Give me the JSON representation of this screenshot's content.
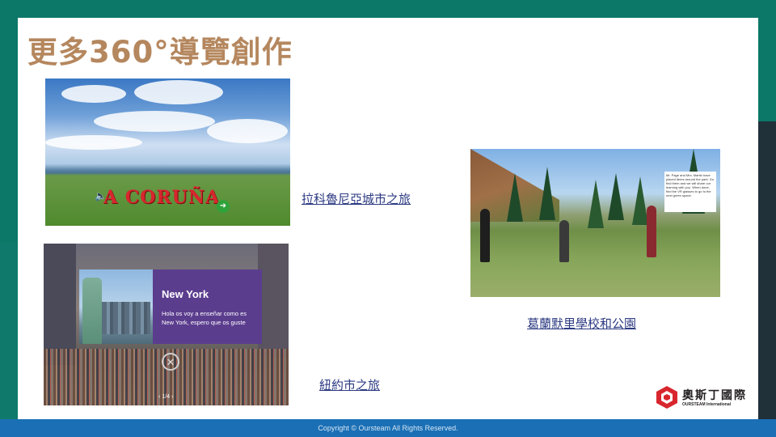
{
  "title": "更多360°導覽創作",
  "tours": [
    {
      "link_label": "拉科魯尼亞城市之旅",
      "image_text": "A CORUÑA"
    },
    {
      "link_label": "紐約市之旅",
      "panel_heading": "New York",
      "panel_body": "Hola os voy a enseñar como es New York, espero que os guste",
      "pager": "1/4"
    },
    {
      "link_label": "葛蘭默里學校和公園",
      "bubble_text": "Mr. Page and Mrs. Martin have placed items around the park. Go find them and we will share our learning with you. When done, find the VR glasses to go to the next green space."
    }
  ],
  "logo": {
    "name_cn": "奧斯丁國際",
    "name_en": "OURSTEAM International"
  },
  "footer": "Copyright © Oursteam All Rights Reserved.",
  "colors": {
    "title": "#b5875e",
    "link": "#2c3a82",
    "footer_bar": "#1a6fb5",
    "frame": "#0c7868",
    "logo_red": "#d8262e"
  }
}
